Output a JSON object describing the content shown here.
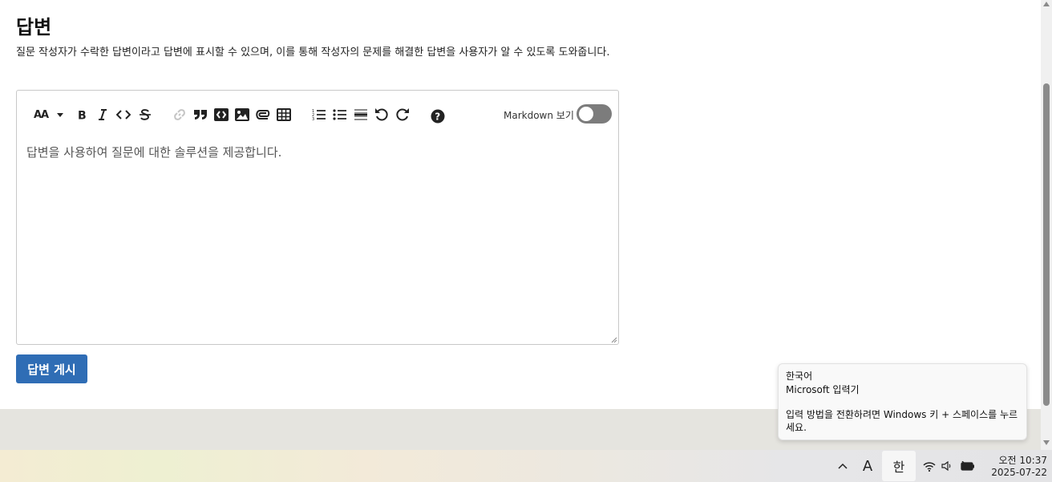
{
  "heading": "답변",
  "description": "질문 작성자가 수락한 답변이라고 답변에 표시할 수 있으며, 이를 통해 작성자의 문제를 해결한 답변을 사용자가 알 수 있도록 도와줍니다.",
  "editor": {
    "toolbar": {
      "heading_label": "AA",
      "markdown_toggle_label": "Markdown 보기",
      "markdown_toggle_on": false,
      "icons": [
        "heading-icon",
        "dropdown-caret-icon",
        "bold-icon",
        "italic-icon",
        "code-icon",
        "strikethrough-icon",
        "link-icon",
        "quote-icon",
        "code-block-icon",
        "image-icon",
        "attachment-icon",
        "table-icon",
        "ordered-list-icon",
        "unordered-list-icon",
        "horizontal-rule-icon",
        "undo-icon",
        "redo-icon",
        "help-icon"
      ]
    },
    "placeholder": "답변을 사용하여 질문에 대한 솔루션을 제공합니다."
  },
  "submit_button": "답변 게시",
  "ime_tooltip": {
    "language": "한국어",
    "ime_name": "Microsoft 입력기",
    "hint": "입력 방법을 전환하려면 Windows 키 + 스페이스를 누르세요."
  },
  "taskbar": {
    "font_indicator": "A",
    "ime_mode": "한",
    "time": "오전 10:37",
    "date": "2025-07-22",
    "tray_icons": [
      "chevron-up-icon",
      "wifi-icon",
      "speaker-icon",
      "battery-icon"
    ]
  },
  "colors": {
    "accent": "#2f6db5",
    "toggle_off": "#7c7c7c"
  }
}
